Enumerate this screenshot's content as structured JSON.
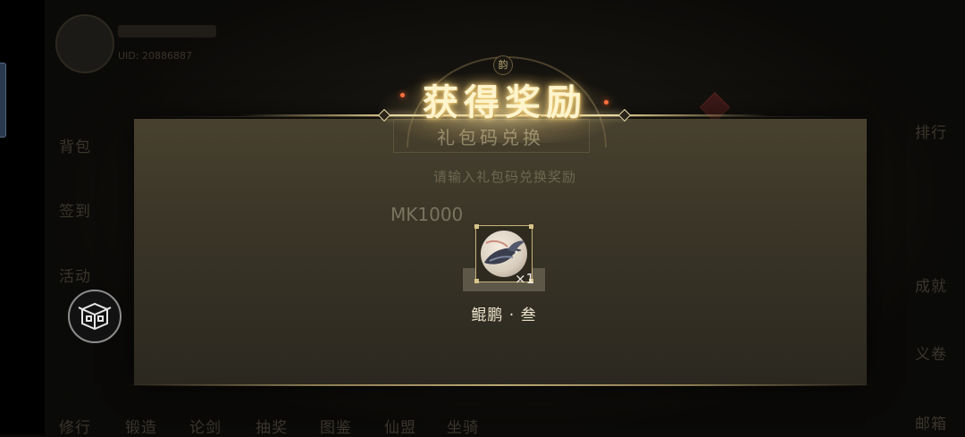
{
  "background": {
    "player_id": "UID: 20886887",
    "right_menu": [
      "排行",
      "成就",
      "义卷",
      "邮箱"
    ],
    "left_menu": [
      "背包",
      "签到",
      "活动"
    ],
    "bottom_menu": [
      "修行",
      "锻造",
      "论剑",
      "抽奖",
      "图鉴",
      "仙盟",
      "坐骑"
    ]
  },
  "redeem_dialog": {
    "title": "礼包码兑换",
    "hint": "请输入礼包码兑换奖励",
    "code_value": "MK1000"
  },
  "reward_popup": {
    "title": "获得奖励",
    "badge_text": "韵",
    "item": {
      "icon": "kunpeng-whale-icon",
      "quantity": "×1",
      "name": "鲲鹏 · 叁"
    }
  },
  "side_button": {
    "icon": "treasure-chest-icon"
  },
  "colors": {
    "title_gold": "#fff4cc",
    "panel": "#3a3527",
    "accent_line": "#e8d9a3"
  }
}
